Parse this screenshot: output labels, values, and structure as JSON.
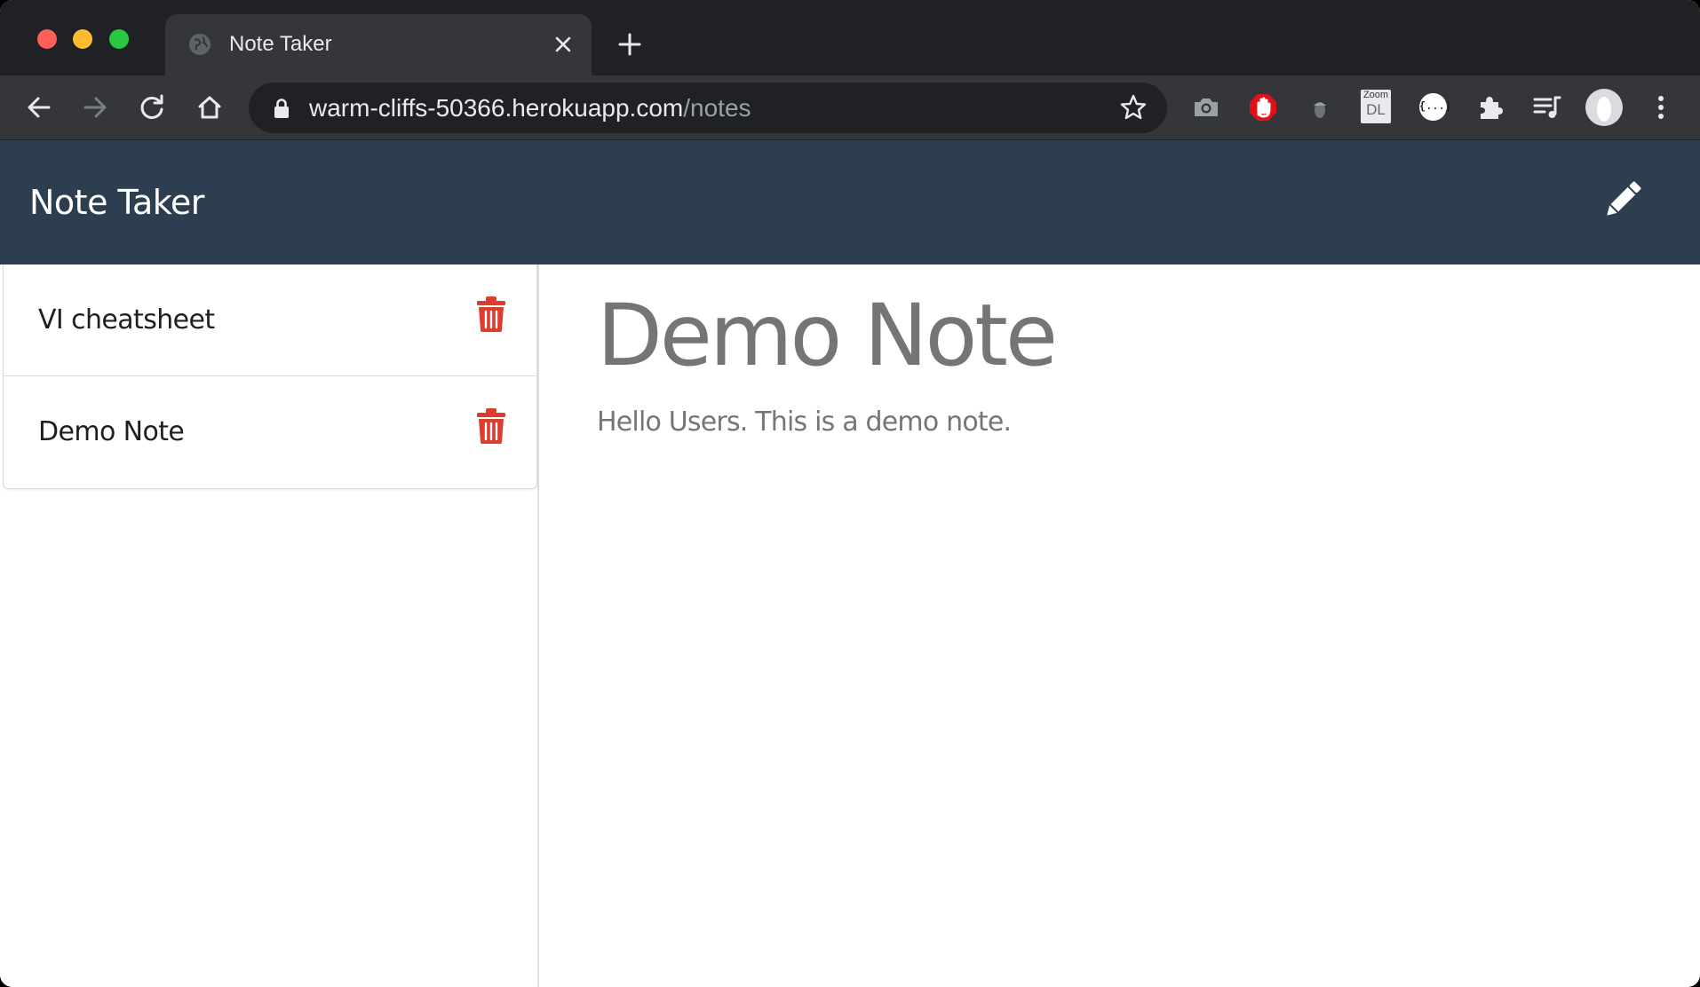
{
  "browser": {
    "tab": {
      "title": "Note Taker"
    },
    "address": {
      "host": "warm-cliffs-50366.herokuapp.com",
      "path": "/notes"
    },
    "extensions": [
      "camera-icon",
      "adblock-hand-icon",
      "acorn-icon",
      "zoom-dl-icon",
      "json-viewer-icon",
      "puzzle-icon",
      "media-queue-icon"
    ],
    "zoom_badge": {
      "top": "Zoom",
      "bottom": "DL"
    },
    "json_badge": "{...}"
  },
  "app": {
    "brand": "Note Taker",
    "accent_color": "#dc3d2f",
    "navbar_color": "#2d3e50"
  },
  "notes": [
    {
      "title": "VI cheatsheet"
    },
    {
      "title": "Demo Note"
    }
  ],
  "active_note": {
    "title": "Demo Note",
    "text": "Hello Users. This is a demo note."
  }
}
